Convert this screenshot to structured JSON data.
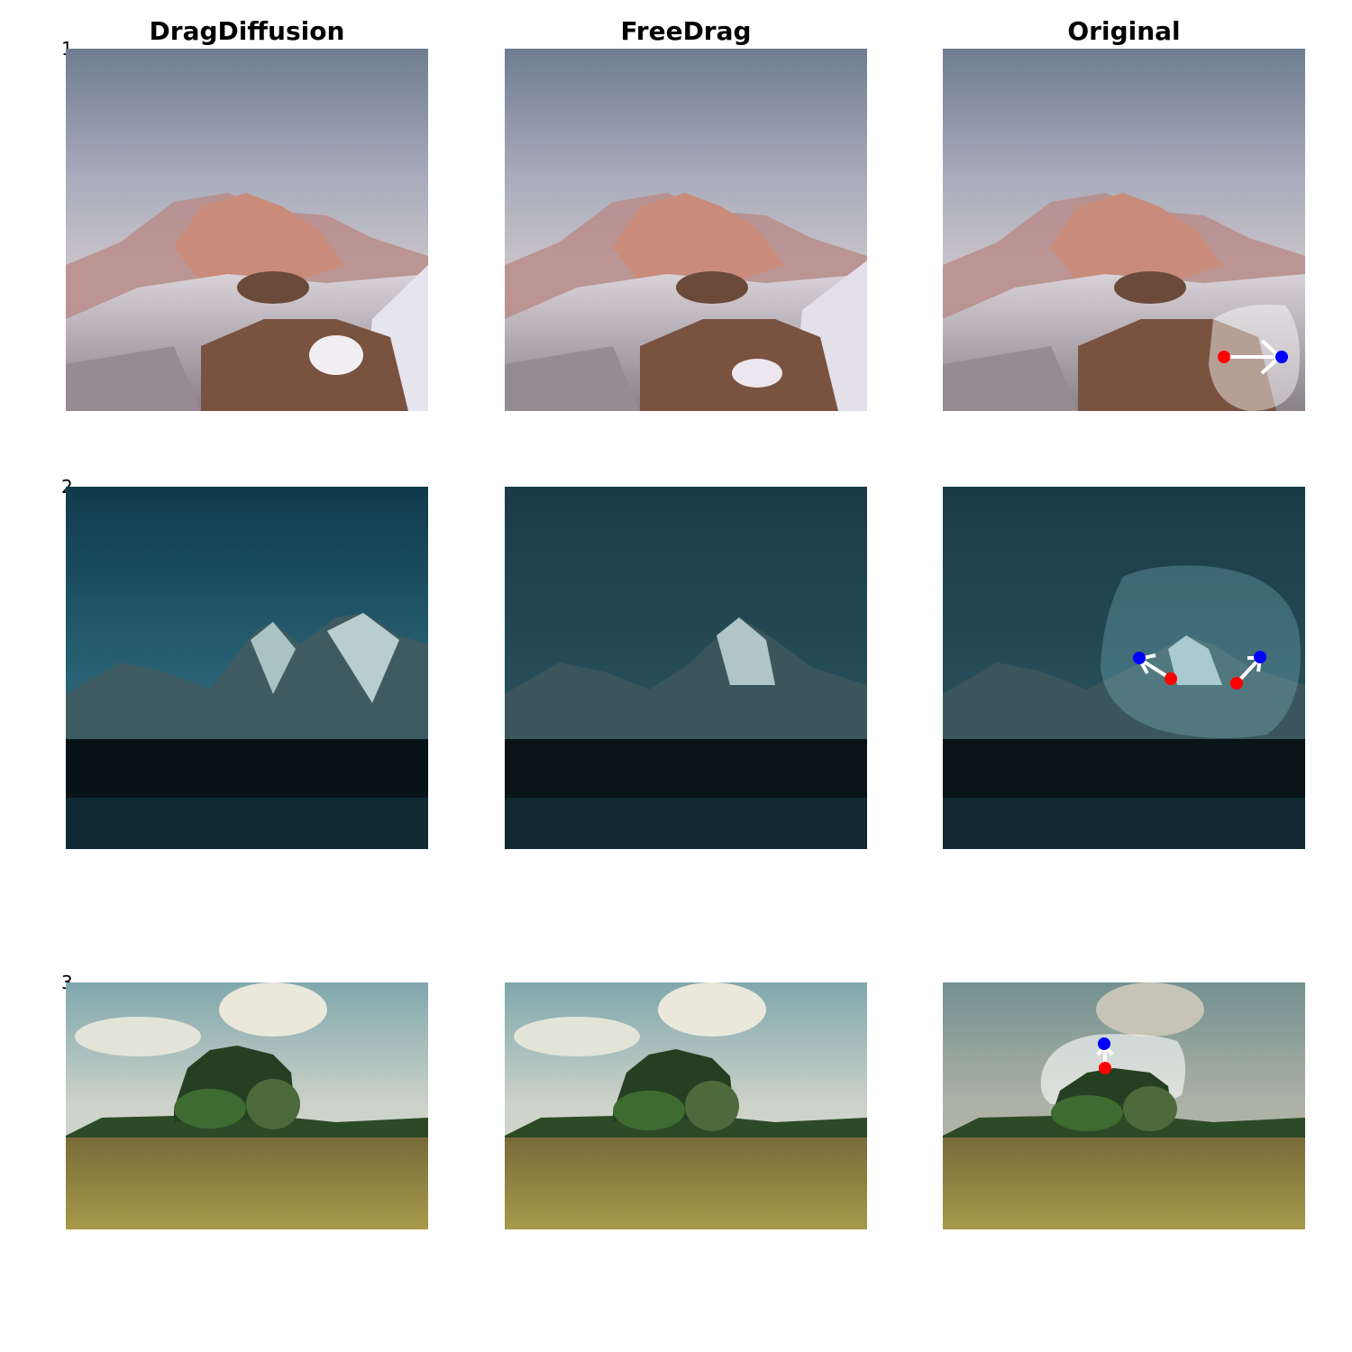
{
  "columns": [
    "DragDiffusion",
    "FreeDrag",
    "Original"
  ],
  "rows": [
    {
      "label": "1",
      "scene": "snowy-rocky-mountains-at-dusk"
    },
    {
      "label": "2",
      "scene": "night-mountain-peaks-teal-sky"
    },
    {
      "label": "3",
      "scene": "poppy-field-with-tree-grove"
    }
  ],
  "colors": {
    "handle_point": "#ff0000",
    "target_point": "#0000ff",
    "drag_arrow": "#ffffff",
    "edit_mask": "rgba(255,255,255,0.35)"
  }
}
